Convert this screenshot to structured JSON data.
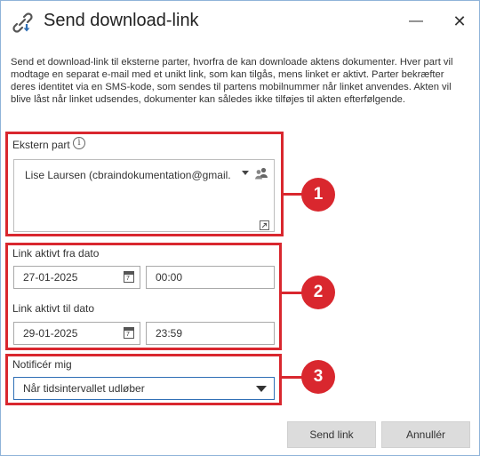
{
  "window": {
    "title": "Send download-link",
    "title_icon": "link-download-icon",
    "minimize_label": "—",
    "close_label": "✕"
  },
  "description": "Send et download-link til eksterne parter, hvorfra de kan downloade aktens dokumenter. Hver part vil modtage en separat e-mail med et unikt link, som kan tilgås, mens linket er aktivt. Parter bekræfter deres identitet via en SMS-kode, som sendes til partens mobilnummer når linket anvendes. Akten vil blive låst når linket udsendes, dokumenter kan således ikke tilføjes til akten efterfølgende.",
  "external_party": {
    "label": "Ekstern part",
    "info_icon": "info-icon",
    "value": "Lise Laursen (cbraindokumentation@gmail.com)",
    "contacts_icon": "contacts-icon",
    "resize_icon": "expand-icon"
  },
  "link_from": {
    "label": "Link aktivt fra dato",
    "date": "27-01-2025",
    "time": "00:00"
  },
  "link_to": {
    "label": "Link aktivt til dato",
    "date": "29-01-2025",
    "time": "23:59"
  },
  "calendar_icon_text": "7",
  "notify": {
    "label": "Notificér mig",
    "selected": "Når tidsintervallet udløber"
  },
  "callouts": [
    "1",
    "2",
    "3"
  ],
  "buttons": {
    "send": "Send link",
    "cancel": "Annullér"
  },
  "colors": {
    "highlight": "#d9272e",
    "select_border": "#2f6fb5",
    "button_bg": "#dcdcdc"
  }
}
